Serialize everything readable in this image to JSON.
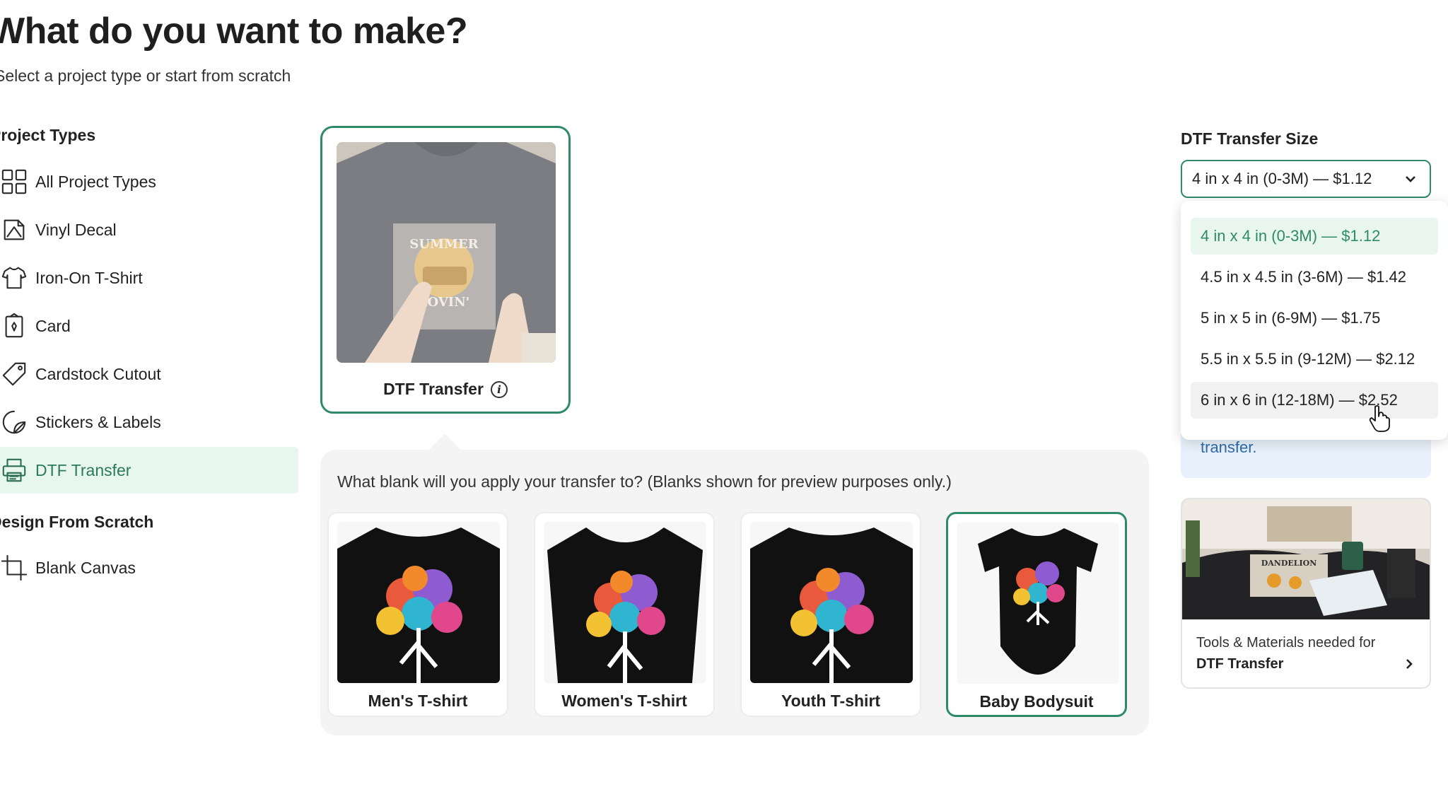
{
  "header": {
    "title": "What do you want to make?",
    "subtitle": "Select a project type or start from scratch"
  },
  "sidebar": {
    "project_types_heading": "Project Types",
    "items": [
      {
        "label": "All Project Types",
        "icon": "grid-icon"
      },
      {
        "label": "Vinyl Decal",
        "icon": "vinyl-decal-icon"
      },
      {
        "label": "Iron-On T-Shirt",
        "icon": "tshirt-icon"
      },
      {
        "label": "Card",
        "icon": "card-icon"
      },
      {
        "label": "Cardstock Cutout",
        "icon": "tag-icon"
      },
      {
        "label": "Stickers & Labels",
        "icon": "sticker-icon"
      },
      {
        "label": "DTF Transfer",
        "icon": "printer-icon",
        "active": true
      }
    ],
    "design_heading": "Design From Scratch",
    "scratch_items": [
      {
        "label": "Blank Canvas",
        "icon": "canvas-crop-icon"
      }
    ]
  },
  "project_card": {
    "label": "DTF Transfer",
    "info_icon": "info-icon",
    "image_text": [
      "SUMMER",
      "LOVIN'"
    ]
  },
  "blank_panel": {
    "question": "What blank will you apply your transfer to? (Blanks shown for preview purposes only.)",
    "blanks": [
      {
        "label": "Men's T-shirt",
        "selected": false
      },
      {
        "label": "Women's T-shirt",
        "selected": false
      },
      {
        "label": "Youth T-shirt",
        "selected": false
      },
      {
        "label": "Baby Bodysuit",
        "selected": true
      }
    ]
  },
  "size_selector": {
    "label": "DTF Transfer Size",
    "selected_value": "4 in x 4 in (0-3M) — $1.12",
    "options": [
      {
        "label": "4 in x 4 in (0-3M) — $1.12",
        "state": "selected"
      },
      {
        "label": "4.5 in x 4.5 in (3-6M) — $1.42",
        "state": "normal"
      },
      {
        "label": "5 in x 5 in (6-9M) — $1.75",
        "state": "normal"
      },
      {
        "label": "5.5 in x 5.5 in (9-12M) — $2.12",
        "state": "normal"
      },
      {
        "label": "6 in x 6 in (12-18M) — $2.52",
        "state": "hover"
      }
    ]
  },
  "info_box": {
    "text": "transfer."
  },
  "tools_card": {
    "line1": "Tools & Materials needed for",
    "line2": "DTF Transfer",
    "image_text": "DANDELION"
  },
  "colors": {
    "accent": "#2f8a68",
    "active_bg": "#e7f6ee",
    "info_bg": "#e8f1fb",
    "info_text": "#2f6ca8"
  }
}
